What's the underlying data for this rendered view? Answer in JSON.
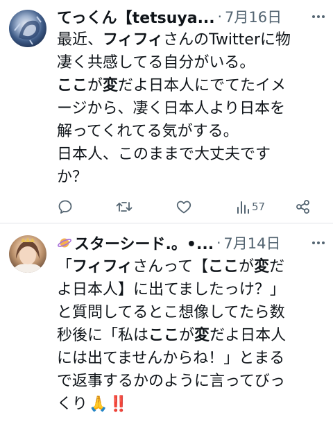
{
  "tweets": [
    {
      "author": "てっくん【tetsuya...",
      "separator": "·",
      "date": "7月16日",
      "lines": [
        [
          {
            "t": "最近、"
          },
          {
            "t": "フィフィ",
            "b": true
          },
          {
            "t": "さんのTwitterに物"
          }
        ],
        [
          {
            "t": "凄く共感してる自分がいる。"
          }
        ],
        [
          {
            "t": "ここ",
            "b": true
          },
          {
            "t": "が"
          },
          {
            "t": "変",
            "b": true
          },
          {
            "t": "だよ日本人にでてたイメ"
          }
        ],
        [
          {
            "t": "ージから、凄く日本人より日本を"
          }
        ],
        [
          {
            "t": "解ってくれてる気がする。"
          }
        ],
        [
          {
            "t": "日本人、このままで大丈夫です"
          }
        ],
        [
          {
            "t": "か？"
          }
        ]
      ],
      "actions": {
        "reply_icon": "reply-icon",
        "retweet_icon": "retweet-icon",
        "like_icon": "heart-icon",
        "views_icon": "views-icon",
        "views_count": "57",
        "share_icon": "share-icon"
      }
    },
    {
      "author": "スターシード.。•...",
      "separator": "·",
      "date": "7月14日",
      "lines": [
        [
          {
            "t": "「"
          },
          {
            "t": "フィフィ",
            "b": true
          },
          {
            "t": "さんって【"
          },
          {
            "t": "ここ",
            "b": true
          },
          {
            "t": "が"
          },
          {
            "t": "変",
            "b": true
          },
          {
            "t": "だ"
          }
        ],
        [
          {
            "t": "よ日本人】に出てましたっけ？」"
          }
        ],
        [
          {
            "t": "と質問してるとこ想像してたら数"
          }
        ],
        [
          {
            "t": "秒後に「私は"
          },
          {
            "t": "ここ",
            "b": true
          },
          {
            "t": "が"
          },
          {
            "t": "変",
            "b": true
          },
          {
            "t": "だよ日本人"
          }
        ],
        [
          {
            "t": "には出てませんからね！」とまる"
          }
        ],
        [
          {
            "t": "で返事するかのように言ってびっ"
          }
        ],
        [
          {
            "t": "くり"
          }
        ]
      ],
      "emojis": [
        "🙏",
        "‼️"
      ]
    }
  ],
  "colors": {
    "text": "#0f1419",
    "secondary": "#536471",
    "divider": "#e1e4e8",
    "emoji_red": "#e0245e"
  }
}
